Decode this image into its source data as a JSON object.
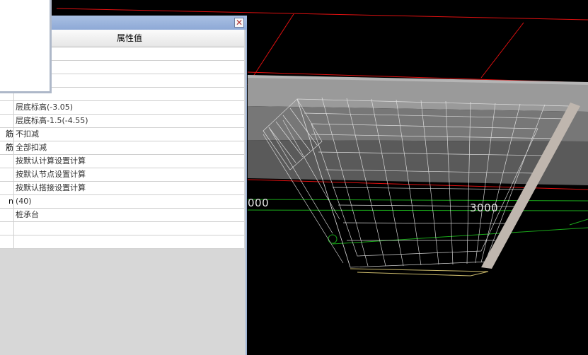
{
  "panel": {
    "close_glyph": "✕",
    "header": {
      "value_col": "属性值"
    },
    "rows": [
      {
        "name": "",
        "value": ""
      },
      {
        "name": "",
        "value": ""
      },
      {
        "name": "",
        "value": ""
      },
      {
        "name": "",
        "value": ""
      },
      {
        "name": "",
        "value": "层底标高(-3.05)"
      },
      {
        "name": "",
        "value": "层底标高-1.5(-4.55)"
      },
      {
        "name": "筋",
        "value": "不扣减"
      },
      {
        "name": "筋",
        "value": "全部扣减"
      },
      {
        "name": "",
        "value": "按默认计算设置计算"
      },
      {
        "name": "",
        "value": "按默认节点设置计算"
      },
      {
        "name": "",
        "value": "按默认搭接设置计算"
      },
      {
        "name": "n",
        "value": "(40)"
      },
      {
        "name": "",
        "value": "桩承台"
      },
      {
        "name": "",
        "value": ""
      },
      {
        "name": "",
        "value": ""
      }
    ]
  },
  "viewport": {
    "labels": {
      "left_dim": "000",
      "right_dim": "3000"
    },
    "colors": {
      "grid_red": "#e01010",
      "grid_green": "#1aa81a",
      "slab": "#8c8c8c",
      "mesh": "#e6e6e6",
      "wedge": "#bfb6ae"
    }
  }
}
